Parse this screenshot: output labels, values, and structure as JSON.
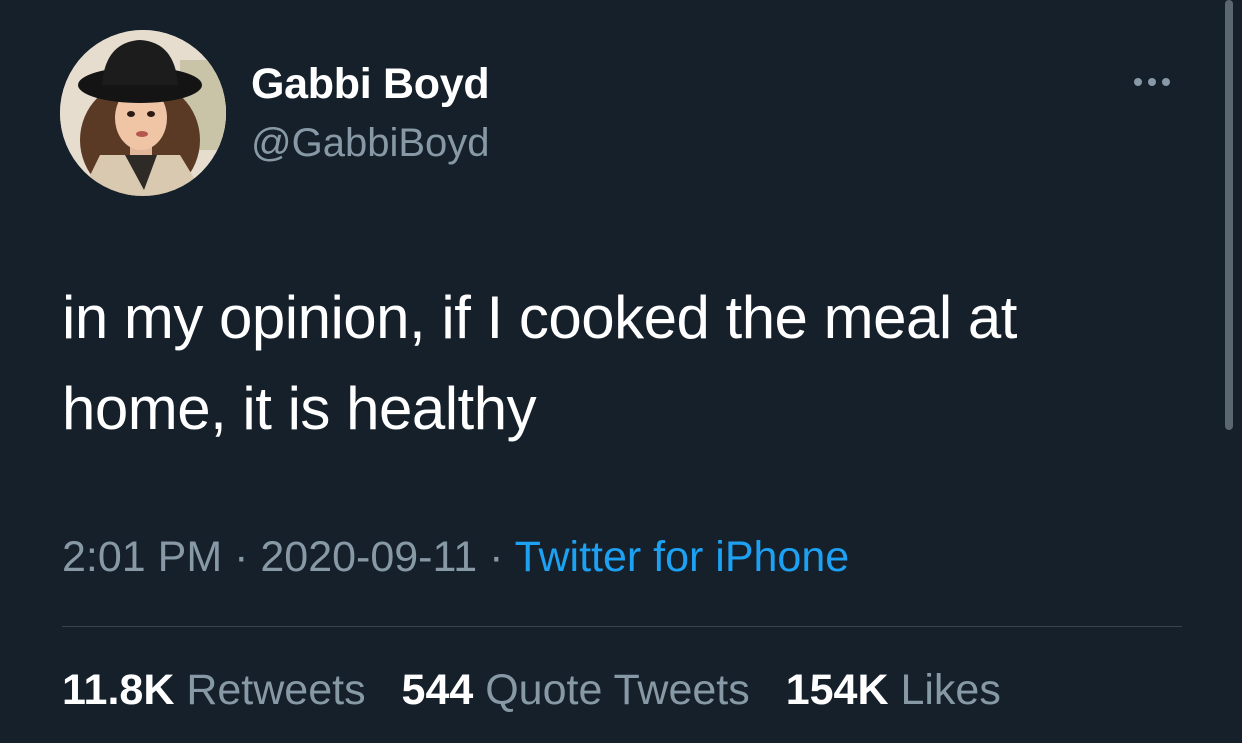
{
  "author": {
    "display_name": "Gabbi Boyd",
    "handle": "@GabbiBoyd"
  },
  "tweet": {
    "text_line1": "in my opinion, if I cooked the meal at",
    "text_line2": "home, it is healthy",
    "time": "2:01 PM",
    "sep1": " · ",
    "date": "2020-09-11",
    "sep2": " · ",
    "source": "Twitter for iPhone"
  },
  "stats": {
    "retweets_count": "11.8K",
    "retweets_label": " Retweets",
    "quotes_count": "544",
    "quotes_label": " Quote Tweets",
    "likes_count": "154K",
    "likes_label": " Likes"
  },
  "icons": {
    "more": "more-options-icon",
    "avatar": "user-avatar"
  },
  "colors": {
    "background": "#15202b",
    "primary_text": "#ffffff",
    "secondary_text": "#8899a6",
    "link": "#1da1f2",
    "divider": "#38444d"
  }
}
